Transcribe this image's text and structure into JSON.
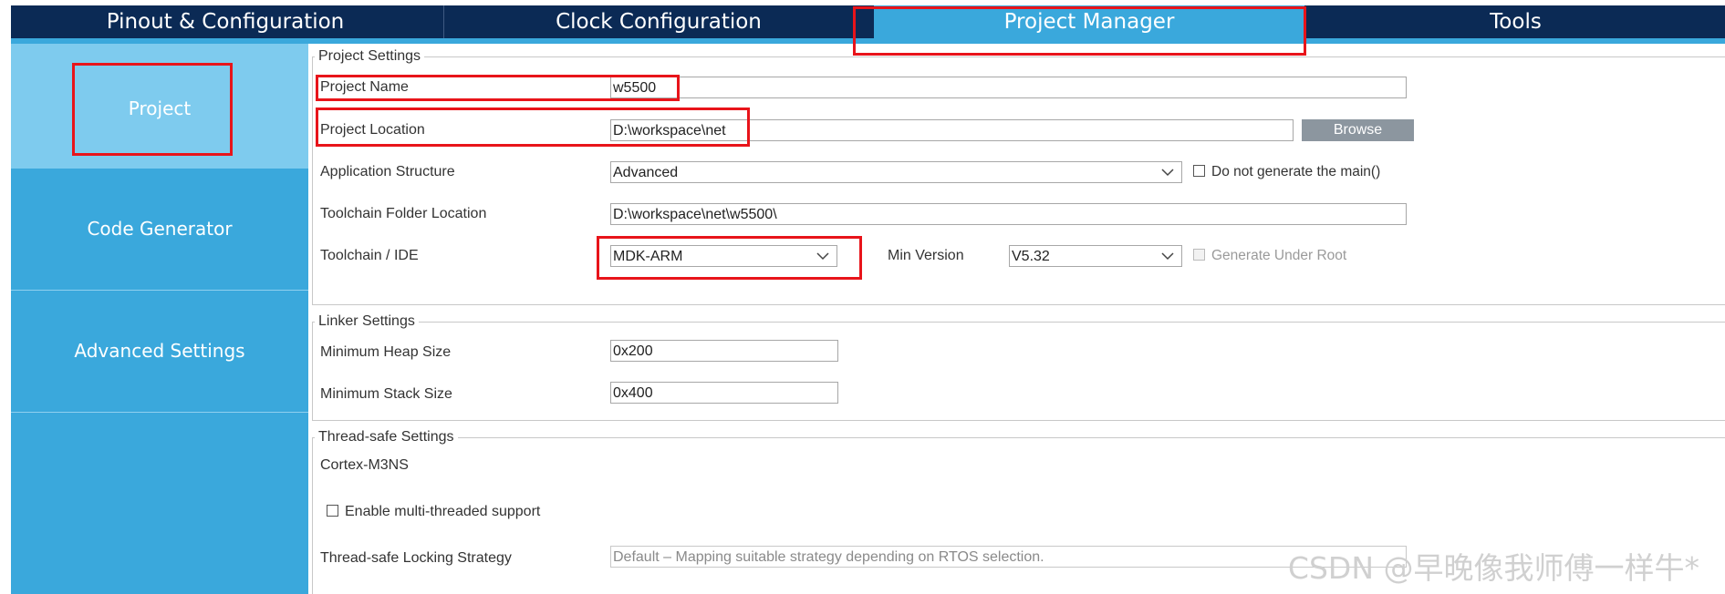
{
  "tabs": [
    {
      "label": "Pinout & Configuration"
    },
    {
      "label": "Clock Configuration"
    },
    {
      "label": "Project Manager"
    },
    {
      "label": "Tools"
    }
  ],
  "sidebar": {
    "items": [
      {
        "label": "Project"
      },
      {
        "label": "Code Generator"
      },
      {
        "label": "Advanced Settings"
      }
    ]
  },
  "project_settings": {
    "title": "Project Settings",
    "project_name_label": "Project Name",
    "project_name_value": "w5500",
    "project_location_label": "Project Location",
    "project_location_value": "D:\\workspace\\net",
    "browse_label": "Browse",
    "app_structure_label": "Application Structure",
    "app_structure_value": "Advanced",
    "no_main_label": "Do not generate the main()",
    "toolchain_folder_label": "Toolchain Folder Location",
    "toolchain_folder_value": "D:\\workspace\\net\\w5500\\",
    "toolchain_ide_label": "Toolchain / IDE",
    "toolchain_ide_value": "MDK-ARM",
    "min_version_label": "Min Version",
    "min_version_value": "V5.32",
    "gen_under_root_label": "Generate Under Root"
  },
  "linker_settings": {
    "title": "Linker Settings",
    "heap_label": "Minimum Heap Size",
    "heap_value": "0x200",
    "stack_label": "Minimum Stack Size",
    "stack_value": "0x400"
  },
  "thread_safe_settings": {
    "title": "Thread-safe Settings",
    "core_label": "Cortex-M3NS",
    "multithread_label": "Enable multi-threaded support",
    "locking_label": "Thread-safe Locking Strategy",
    "locking_value": "Default  –  Mapping suitable strategy depending on RTOS selection."
  },
  "watermark": "CSDN @早晚像我师傅一样牛*",
  "colors": {
    "tabbar": "#0b2a55",
    "accent": "#3aa8dc",
    "sidebar_active": "#7ecbee",
    "highlight": "#e8141a"
  }
}
